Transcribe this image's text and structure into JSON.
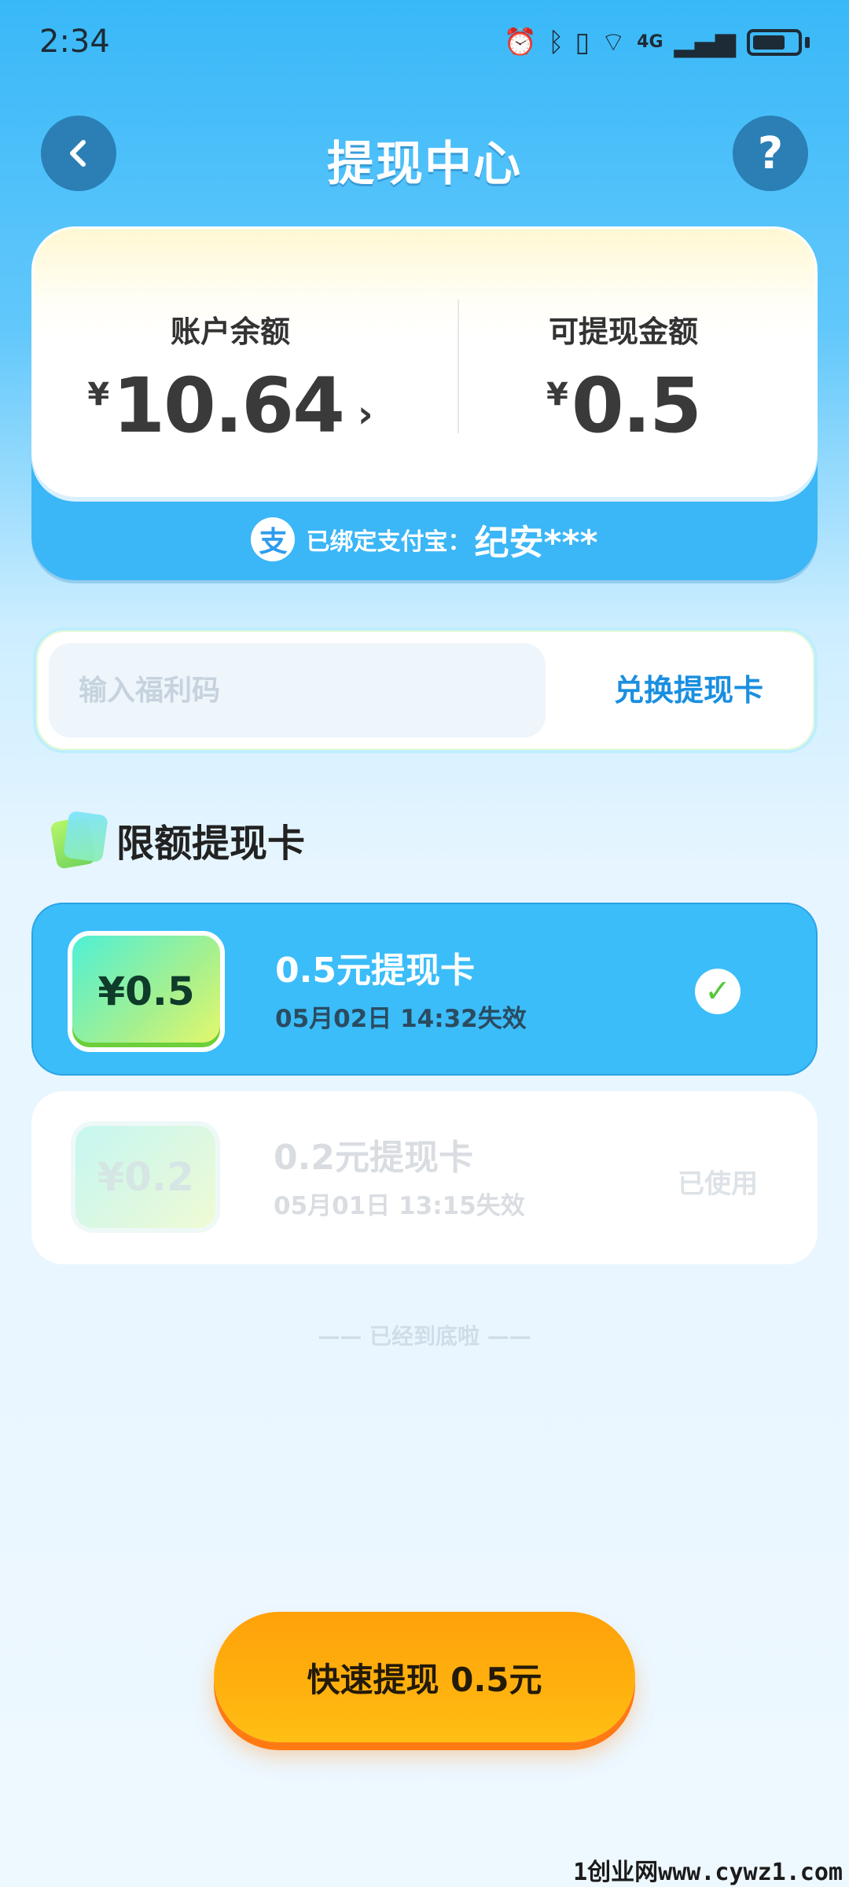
{
  "status_bar": {
    "time": "2:34",
    "network": "4G"
  },
  "header": {
    "title": "提现中心",
    "help_glyph": "?"
  },
  "balance": {
    "account_label": "账户余额",
    "currency": "¥",
    "account_amount": "10.64",
    "withdrawable_label": "可提现金额",
    "withdrawable_amount": "0.5",
    "alipay_icon_glyph": "支",
    "alipay_label": "已绑定支付宝：",
    "alipay_name": "纪安***"
  },
  "promo": {
    "placeholder": "输入福利码",
    "redeem_label": "兑换提现卡"
  },
  "section": {
    "title": "限额提现卡"
  },
  "cards": [
    {
      "coupon_value": "¥0.5",
      "title": "0.5元提现卡",
      "expire": "05月02日 14:32失效",
      "state": "selected"
    },
    {
      "coupon_value": "¥0.2",
      "title": "0.2元提现卡",
      "expire": "05月01日 13:15失效",
      "state": "used",
      "state_label": "已使用"
    }
  ],
  "end_note": "—— 已经到底啦 ——",
  "cta": {
    "label": "快速提现 0.5元"
  },
  "watermark": "1创业网www.cywz1.com",
  "colors": {
    "primary_blue": "#3bbdf9",
    "accent_orange": "#ffa10a",
    "link_blue": "#1a8fe0",
    "check_green": "#56c83a"
  }
}
